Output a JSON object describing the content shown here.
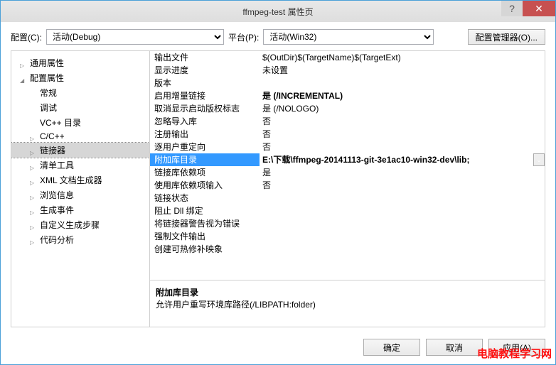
{
  "window": {
    "title": "ffmpeg-test 属性页"
  },
  "toolbar": {
    "config_label": "配置(C):",
    "config_value": "活动(Debug)",
    "platform_label": "平台(P):",
    "platform_value": "活动(Win32)",
    "manager_label": "配置管理器(O)..."
  },
  "tree": {
    "items": [
      {
        "label": "通用属性",
        "depth": 0,
        "caret": "col"
      },
      {
        "label": "配置属性",
        "depth": 0,
        "caret": "exp"
      },
      {
        "label": "常规",
        "depth": 1
      },
      {
        "label": "调试",
        "depth": 1
      },
      {
        "label": "VC++ 目录",
        "depth": 1
      },
      {
        "label": "C/C++",
        "depth": 1,
        "caret": "col"
      },
      {
        "label": "链接器",
        "depth": 1,
        "caret": "col",
        "sel": true
      },
      {
        "label": "清单工具",
        "depth": 1,
        "caret": "col"
      },
      {
        "label": "XML 文档生成器",
        "depth": 1,
        "caret": "col"
      },
      {
        "label": "浏览信息",
        "depth": 1,
        "caret": "col"
      },
      {
        "label": "生成事件",
        "depth": 1,
        "caret": "col"
      },
      {
        "label": "自定义生成步骤",
        "depth": 1,
        "caret": "col"
      },
      {
        "label": "代码分析",
        "depth": 1,
        "caret": "col"
      }
    ]
  },
  "props": [
    {
      "name": "输出文件",
      "value": "$(OutDir)$(TargetName)$(TargetExt)"
    },
    {
      "name": "显示进度",
      "value": "未设置"
    },
    {
      "name": "版本",
      "value": ""
    },
    {
      "name": "启用增量链接",
      "value": "是 (/INCREMENTAL)",
      "bold": true
    },
    {
      "name": "取消显示启动版权标志",
      "value": "是 (/NOLOGO)"
    },
    {
      "name": "忽略导入库",
      "value": "否"
    },
    {
      "name": "注册输出",
      "value": "否"
    },
    {
      "name": "逐用户重定向",
      "value": "否"
    },
    {
      "name": "附加库目录",
      "value": "E:\\下载\\ffmpeg-20141113-git-3e1ac10-win32-dev\\lib;",
      "sel": true
    },
    {
      "name": "链接库依赖项",
      "value": "是"
    },
    {
      "name": "使用库依赖项输入",
      "value": "否"
    },
    {
      "name": "链接状态",
      "value": ""
    },
    {
      "name": "阻止 Dll 绑定",
      "value": ""
    },
    {
      "name": "将链接器警告视为错误",
      "value": ""
    },
    {
      "name": "强制文件输出",
      "value": ""
    },
    {
      "name": "创建可热修补映象",
      "value": ""
    }
  ],
  "desc": {
    "title": "附加库目录",
    "text": "允许用户重写环境库路径(/LIBPATH:folder)"
  },
  "footer": {
    "ok": "确定",
    "cancel": "取消",
    "apply": "应用(A)"
  },
  "watermark": "电脑教程学习网"
}
